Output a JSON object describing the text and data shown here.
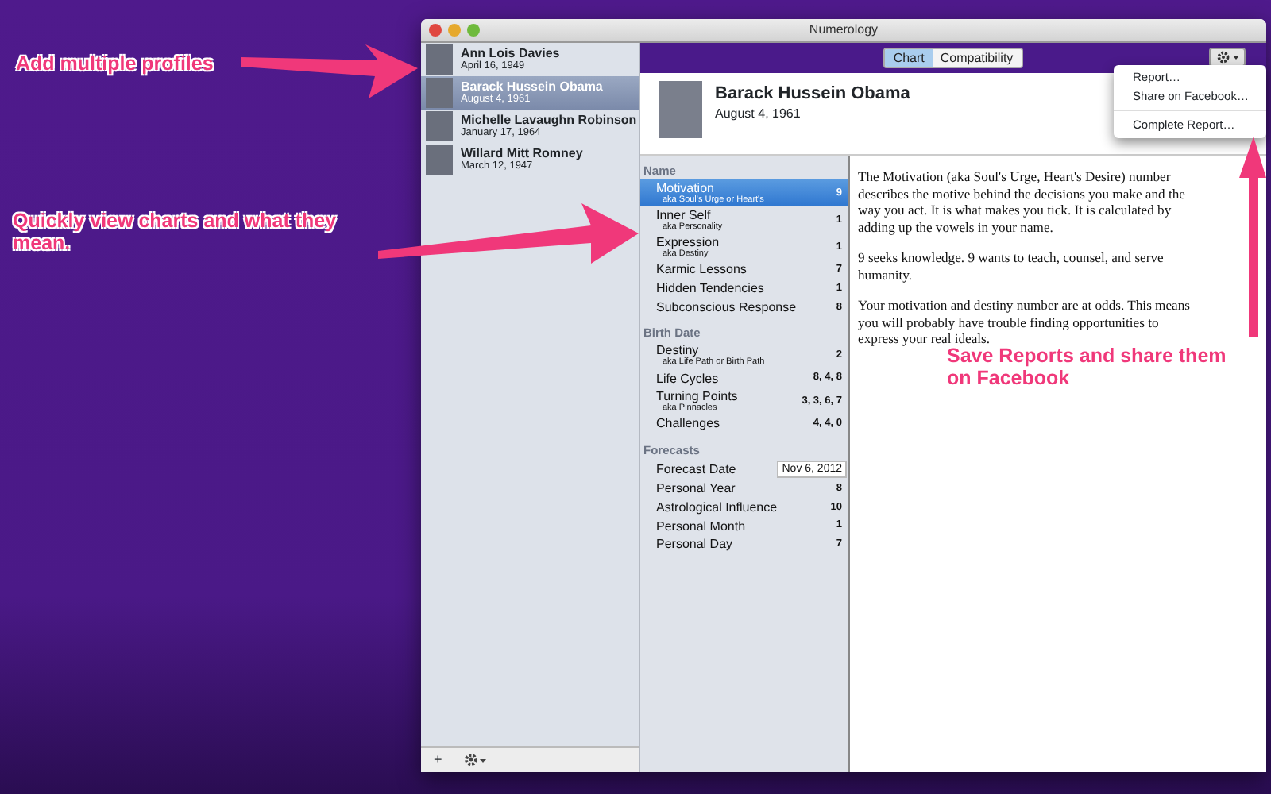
{
  "annotations": [
    {
      "text": "Add multiple profiles"
    },
    {
      "text": "Quickly view charts and what they mean."
    },
    {
      "text": "Save Reports and share them on Facebook"
    }
  ],
  "window": {
    "title": "Numerology"
  },
  "profiles": [
    {
      "name": "Ann Lois Davies",
      "date": "April 16, 1949",
      "selected": false
    },
    {
      "name": "Barack Hussein Obama",
      "date": "August 4, 1961",
      "selected": true
    },
    {
      "name": "Michelle Lavaughn Robinson",
      "date": "January 17, 1964",
      "selected": false
    },
    {
      "name": "Willard Mitt Romney",
      "date": "March 12, 1947",
      "selected": false
    }
  ],
  "sidebar_footer": {
    "add": "+"
  },
  "tabs": [
    {
      "label": "Chart",
      "selected": true
    },
    {
      "label": "Compatibility",
      "selected": false
    }
  ],
  "header": {
    "name": "Barack Hussein Obama",
    "date": "August 4, 1961"
  },
  "sections": [
    {
      "title": "Name",
      "items": [
        {
          "kind": "text",
          "label": "Motivation",
          "sublabel": "aka Soul's Urge or Heart's",
          "value": "9",
          "selected": true
        },
        {
          "kind": "text",
          "label": "Inner Self",
          "sublabel": "aka Personality",
          "value": "1",
          "selected": false
        },
        {
          "kind": "text",
          "label": "Expression",
          "sublabel": "aka Destiny",
          "value": "1",
          "selected": false
        },
        {
          "kind": "text",
          "label": "Karmic Lessons",
          "value": "7",
          "selected": false
        },
        {
          "kind": "text",
          "label": "Hidden Tendencies",
          "value": "1",
          "selected": false
        },
        {
          "kind": "text",
          "label": "Subconscious Response",
          "value": "8",
          "selected": false
        }
      ]
    },
    {
      "title": "Birth Date",
      "items": [
        {
          "kind": "text",
          "label": "Destiny",
          "sublabel": "aka Life Path or Birth Path",
          "value": "2",
          "selected": false
        },
        {
          "kind": "text",
          "label": "Life Cycles",
          "value": "8, 4, 8",
          "selected": false
        },
        {
          "kind": "text",
          "label": "Turning Points",
          "sublabel": "aka Pinnacles",
          "value": "3, 3, 6, 7",
          "selected": false
        },
        {
          "kind": "text",
          "label": "Challenges",
          "value": "4, 4, 0",
          "selected": false
        }
      ]
    },
    {
      "title": "Forecasts",
      "items": [
        {
          "kind": "field",
          "label": "Forecast Date",
          "value": "Nov 6, 2012",
          "selected": false
        },
        {
          "kind": "text",
          "label": "Personal Year",
          "value": "8",
          "selected": false
        },
        {
          "kind": "text",
          "label": "Astrological Influence",
          "value": "10",
          "selected": false
        },
        {
          "kind": "text",
          "label": "Personal Month",
          "value": "1",
          "selected": false
        },
        {
          "kind": "text",
          "label": "Personal Day",
          "value": "7",
          "selected": false
        }
      ]
    }
  ],
  "description": [
    "The Motivation (aka Soul's Urge, Heart's Desire) number describes the motive behind the decisions you make and the way you act. It is what makes you tick. It is calculated by adding up the vowels in your name.",
    "9 seeks knowledge. 9 wants to teach, counsel, and serve humanity.",
    "Your motivation and destiny number are at odds. This means you will probably have trouble finding opportunities to express your real ideals."
  ],
  "menu": [
    [
      {
        "label": "Report…"
      },
      {
        "label": "Share on Facebook…"
      }
    ],
    [
      {
        "label": "Complete Report…"
      }
    ]
  ]
}
